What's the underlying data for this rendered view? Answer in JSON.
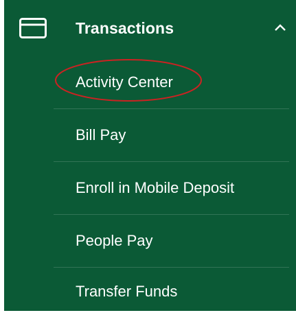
{
  "menu": {
    "header": {
      "title": "Transactions",
      "icon": "credit-card-icon",
      "toggle_icon": "chevron-up-icon"
    },
    "items": [
      {
        "label": "Activity Center"
      },
      {
        "label": "Bill Pay"
      },
      {
        "label": "Enroll in Mobile Deposit"
      },
      {
        "label": "People Pay"
      },
      {
        "label": "Transfer Funds"
      }
    ]
  },
  "colors": {
    "menu_background": "#0b5a36",
    "text": "#ffffff",
    "annotation": "#cc2222"
  }
}
